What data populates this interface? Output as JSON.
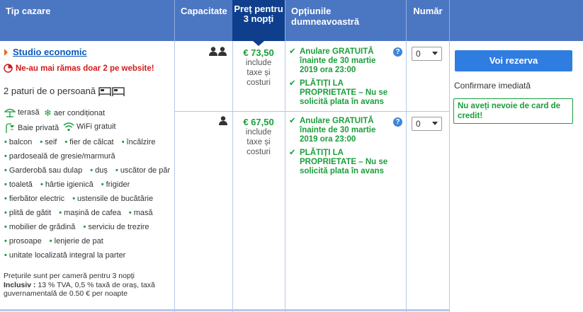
{
  "header": {
    "room_type": "Tip cazare",
    "capacity": "Capacitate",
    "price": "Preț pentru 3 nopți",
    "options": "Opțiunile dumneavoastră",
    "number": "Număr"
  },
  "room": {
    "name": "Studio economic",
    "urgency": "Ne-au mai rămas doar 2 pe website!",
    "beds": "2 paturi de o persoană",
    "facilities": [
      {
        "icon": "umbrella-icon",
        "label": "terasă"
      },
      {
        "icon": "snowflake-icon",
        "label": "aer condiționat"
      },
      {
        "icon": "shower-icon",
        "label": "Baie privată"
      },
      {
        "icon": "wifi-icon",
        "label": "WiFi gratuit"
      }
    ],
    "amenities_rows": [
      [
        "balcon",
        "seif",
        "fier de călcat",
        "încălzire"
      ],
      [
        "pardoseală de gresie/marmură"
      ],
      [
        "Garderobă sau dulap",
        "duș",
        "uscător de păr"
      ],
      [
        "toaletă",
        "hârtie igienică",
        "frigider"
      ],
      [
        "fierbător electric",
        "ustensile de bucătărie"
      ],
      [
        "plită de gătit",
        "mașină de cafea",
        "masă"
      ],
      [
        "mobilier de grădină",
        "serviciu de trezire"
      ],
      [
        "prosoape",
        "lenjerie de pat"
      ],
      [
        "unitate localizată integral la parter"
      ]
    ],
    "footnote_line1": "Prețurile sunt per cameră pentru 3 nopți",
    "footnote_bold": "Inclusiv :",
    "footnote_rest": " 13 % TVA, 0,5 % taxă de oraș, taxă guvernamentală de 0.50 € per noapte"
  },
  "rates": [
    {
      "occupancy": 2,
      "price": "€ 73,50",
      "price_note_1": "include",
      "price_note_2": "taxe și",
      "price_note_3": "costuri",
      "cancel_l1": "Anulare GRATUITĂ",
      "cancel_l2": "înainte de 30 martie",
      "cancel_l3": "2019 ora 23:00",
      "pay_l1": "PLĂTIȚI LA",
      "pay_l2": "PROPRIETATE – Nu se",
      "pay_l3": "solicită plata în avans",
      "selected": "0"
    },
    {
      "occupancy": 1,
      "price": "€ 67,50",
      "price_note_1": "include",
      "price_note_2": "taxe și",
      "price_note_3": "costuri",
      "cancel_l1": "Anulare GRATUITĂ",
      "cancel_l2": "înainte de 30 martie",
      "cancel_l3": "2019 ora 23:00",
      "pay_l1": "PLĂTIȚI LA",
      "pay_l2": "PROPRIETATE – Nu se",
      "pay_l3": "solicită plata în avans",
      "selected": "0"
    }
  ],
  "actions": {
    "reserve": "Voi rezerva",
    "confirm": "Confirmare imediată",
    "no_card": "Nu aveți nevoie de card de credit!"
  },
  "colors": {
    "header_bg": "#4b76c2",
    "price_header_bg": "#0f3f8c",
    "green": "#1a9e3a",
    "link_blue": "#0c59b9",
    "button_blue": "#2f7de1",
    "urgency_red": "#d21a1a"
  }
}
